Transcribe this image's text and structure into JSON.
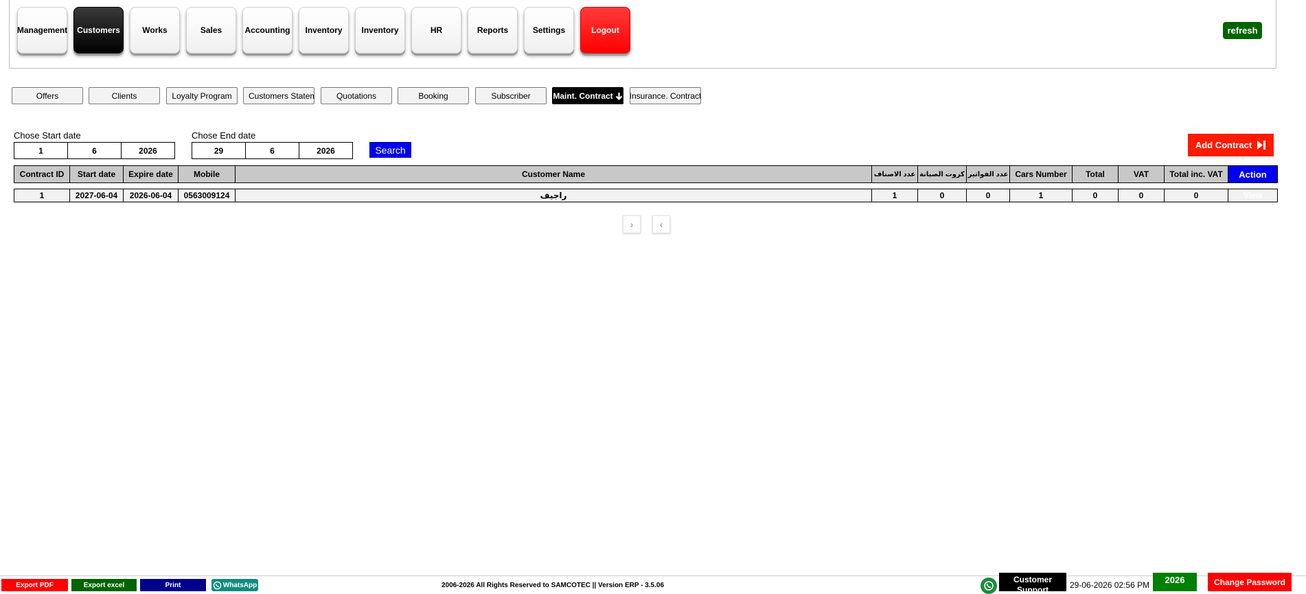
{
  "nav": {
    "items": [
      {
        "label": "Management"
      },
      {
        "label": "Customers"
      },
      {
        "label": "Works"
      },
      {
        "label": "Sales"
      },
      {
        "label": "Accounting"
      },
      {
        "label": "Inventory"
      },
      {
        "label": "Inventory"
      },
      {
        "label": "HR"
      },
      {
        "label": "Reports"
      },
      {
        "label": "Settings"
      },
      {
        "label": "Logout"
      }
    ],
    "active": "Customers",
    "refresh_label": "refresh"
  },
  "subtabs": [
    {
      "label": "Offers"
    },
    {
      "label": "Clients"
    },
    {
      "label": "Loyalty Program"
    },
    {
      "label": "Customers Statement"
    },
    {
      "label": "Quotations"
    },
    {
      "label": "Booking"
    },
    {
      "label": "Subscriber"
    },
    {
      "label": "Maint. Contract"
    },
    {
      "label": "Insurance. Contract"
    }
  ],
  "filters": {
    "start_label": "Chose Start date",
    "start": {
      "day": "1",
      "month": "6",
      "year": "2026"
    },
    "end_label": "Chose End date",
    "end": {
      "day": "29",
      "month": "6",
      "year": "2026"
    },
    "search_label": "Search",
    "add_label": "Add Contract"
  },
  "table": {
    "headers": [
      "Contract ID",
      "Start date",
      "Expire date",
      "Mobile",
      "Customer Name",
      "عدد الاصناف",
      "كروت الصيانة",
      "عدد الفواتير",
      "Cars Number",
      "Total",
      "VAT",
      "Total inc. VAT",
      "Action"
    ],
    "rows": [
      {
        "id": "1",
        "start": "2027-06-04",
        "expire": "2026-06-04",
        "mobile": "0563009124",
        "name": "راجيف",
        "items": "1",
        "cards": "0",
        "invoices": "0",
        "cars": "1",
        "total": "0",
        "vat": "0",
        "total_vat": "0",
        "action": "View"
      }
    ]
  },
  "pagination": {
    "next": "›",
    "prev": "‹"
  },
  "footer": {
    "export_pdf": "Export PDF",
    "export_excel": "Export excel",
    "print": "Print",
    "whatsapp": "WhatsApp",
    "copyright": "2006-2026 All Rights Reserved to SAMCOTEC || Version ERP - 3.5.06",
    "support": "Customer Support",
    "datetime": "29-06-2026 02:56 PM",
    "year": "2026",
    "change_password": "Change Password"
  },
  "colors": {
    "accent_blue": "#0000ee",
    "danger_red": "#ff0000",
    "success_green": "#006400"
  }
}
